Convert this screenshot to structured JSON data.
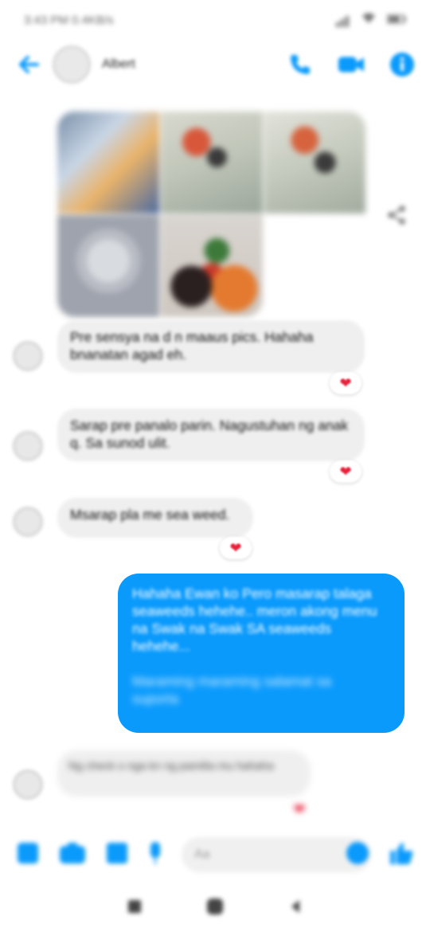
{
  "status_bar": {
    "time": "3:43 PM",
    "extra": "0.4KB/s"
  },
  "header": {
    "contact_name": "Albert"
  },
  "colors": {
    "accent": "#0a9afc",
    "reaction": "#e8213b",
    "incoming_bubble": "#efefef"
  },
  "messages": [
    {
      "id": "m1",
      "text": "Pre sensya na d n maaus pics. Hahaha bnanatan agad eh.",
      "reaction": "heart"
    },
    {
      "id": "m2",
      "text": "Sarap pre panalo parin. Nagustuhan ng anak q. Sa sunod ulit.",
      "reaction": "heart"
    },
    {
      "id": "m3",
      "text": "Msarap pla me sea weed.",
      "reaction": "heart"
    },
    {
      "id": "m4",
      "text": "Hahaha Ewan ko Pero masarap talaga seaweeds hehehe.. meron akong menu na Swak na Swak SA seaweeds hehehe...",
      "text2": "Maraming maraming salamat sa suporta",
      "outgoing": true
    },
    {
      "id": "m5",
      "text": "Ng check o nga kn ng pamilia mu hahaha",
      "reaction": "heart"
    }
  ],
  "composer": {
    "placeholder": "Aa"
  },
  "icons": {
    "back": "arrow-left-icon",
    "call": "phone-icon",
    "video": "video-camera-icon",
    "info": "info-icon",
    "share": "share-icon",
    "menu": "grid-menu-icon",
    "camera": "camera-icon",
    "gallery": "image-icon",
    "mic": "microphone-icon",
    "emoji": "emoji-icon",
    "like": "thumbs-up-icon"
  }
}
